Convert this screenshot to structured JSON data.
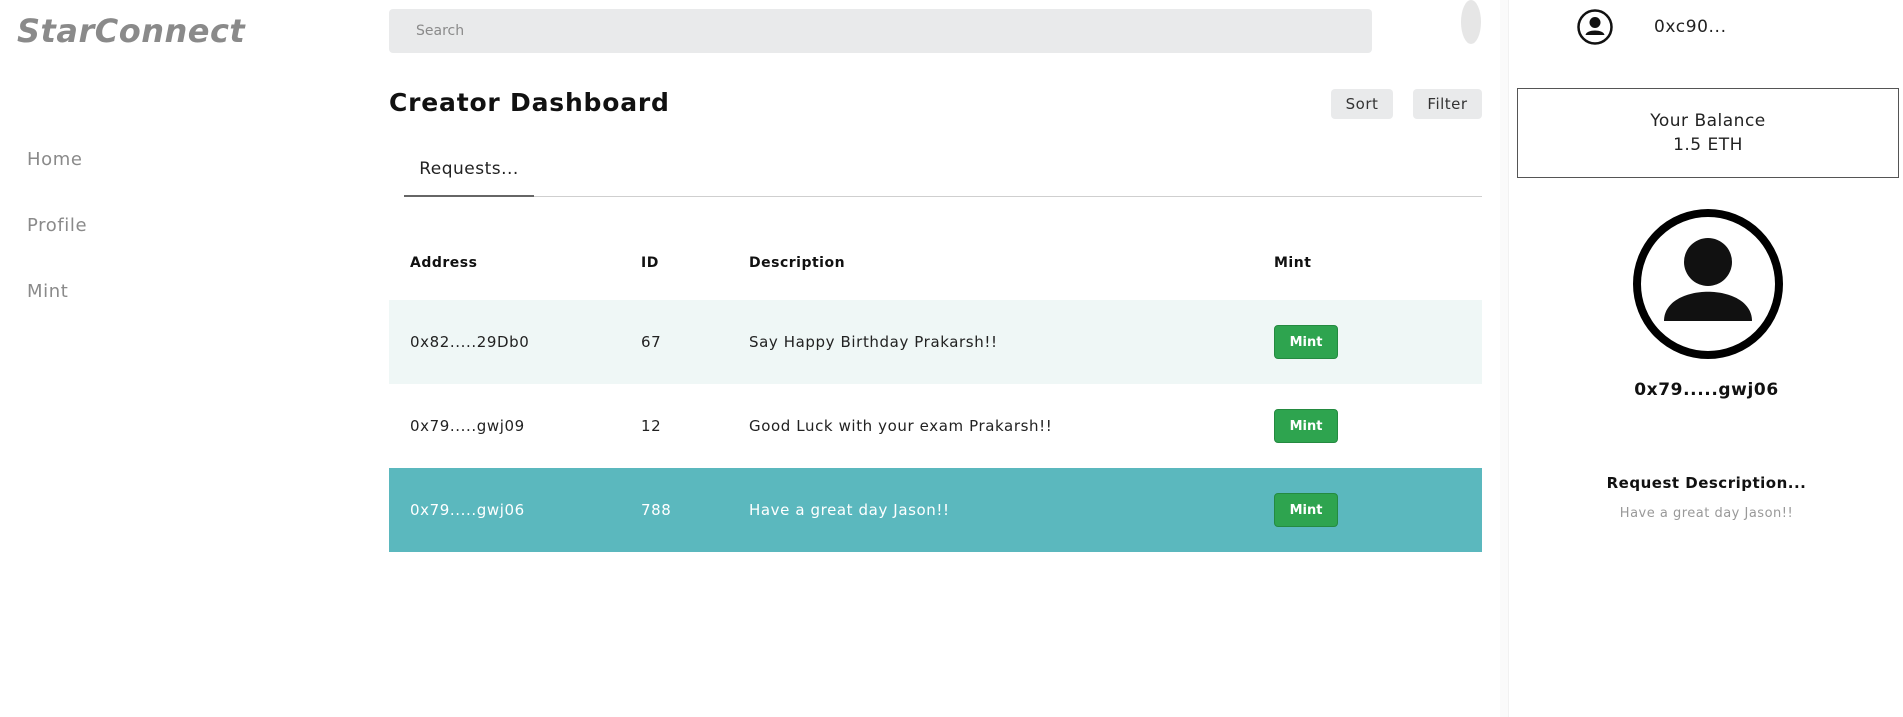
{
  "app": {
    "logo": "StarConnect"
  },
  "sidebar": {
    "items": [
      {
        "label": "Home"
      },
      {
        "label": "Profile"
      },
      {
        "label": "Mint"
      }
    ]
  },
  "search": {
    "placeholder": "Search",
    "value": ""
  },
  "main": {
    "title": "Creator Dashboard",
    "sort_label": "Sort",
    "filter_label": "Filter",
    "tabs": [
      {
        "label": "Requests..."
      }
    ]
  },
  "table": {
    "columns": [
      "Address",
      "ID",
      "Description",
      "Mint"
    ],
    "rows": [
      {
        "address": "0x82.....29Db0",
        "id": "67",
        "description": "Say Happy Birthday Prakarsh!!",
        "action": "Mint"
      },
      {
        "address": "0x79.....gwj09",
        "id": "12",
        "description": "Good Luck with your exam Prakarsh!!",
        "action": "Mint"
      },
      {
        "address": "0x79.....gwj06",
        "id": "788",
        "description": "Have a great day Jason!!",
        "action": "Mint"
      }
    ]
  },
  "right_panel": {
    "account_address": "0xc90...",
    "balance_label": "Your Balance",
    "balance_value": "1.5 ETH",
    "selected_address": "0x79.....gwj06",
    "description_title": "Request Description...",
    "description_text": "Have a great day Jason!!"
  },
  "icons": {
    "account": "user-circle-icon",
    "avatar": "user-avatar-icon"
  },
  "colors": {
    "row_alt": "#eff7f6",
    "row_selected": "#5bb8be",
    "mint_button": "#2ea44f",
    "logo": "#8a8a8a"
  }
}
